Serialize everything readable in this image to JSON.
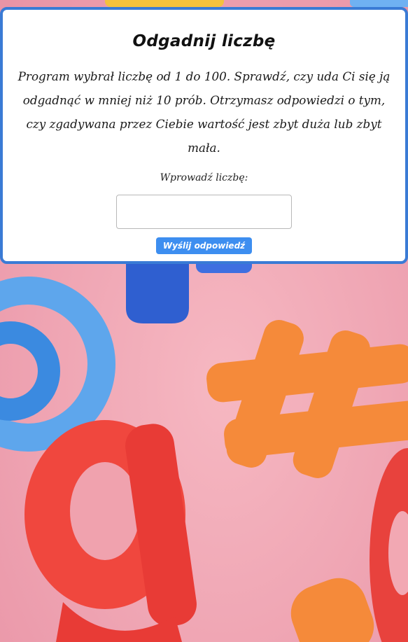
{
  "game": {
    "title": "Odgadnij liczbę",
    "description": "Program wybrał liczbę od 1 do 100. Sprawdź, czy uda Ci się ją odgadnąć w mniej niż 10 prób. Otrzymasz odpowiedzi o tym, czy zgadywana przez Ciebie wartość jest zbyt duża lub zbyt mała.",
    "input_label": "Wprowadź liczbę:",
    "input_value": "",
    "submit_label": "Wyślij odpowiedź"
  },
  "colors": {
    "card_border": "#3a7bd5",
    "button": "#3d8ef0",
    "background": "#f0a6b4"
  }
}
